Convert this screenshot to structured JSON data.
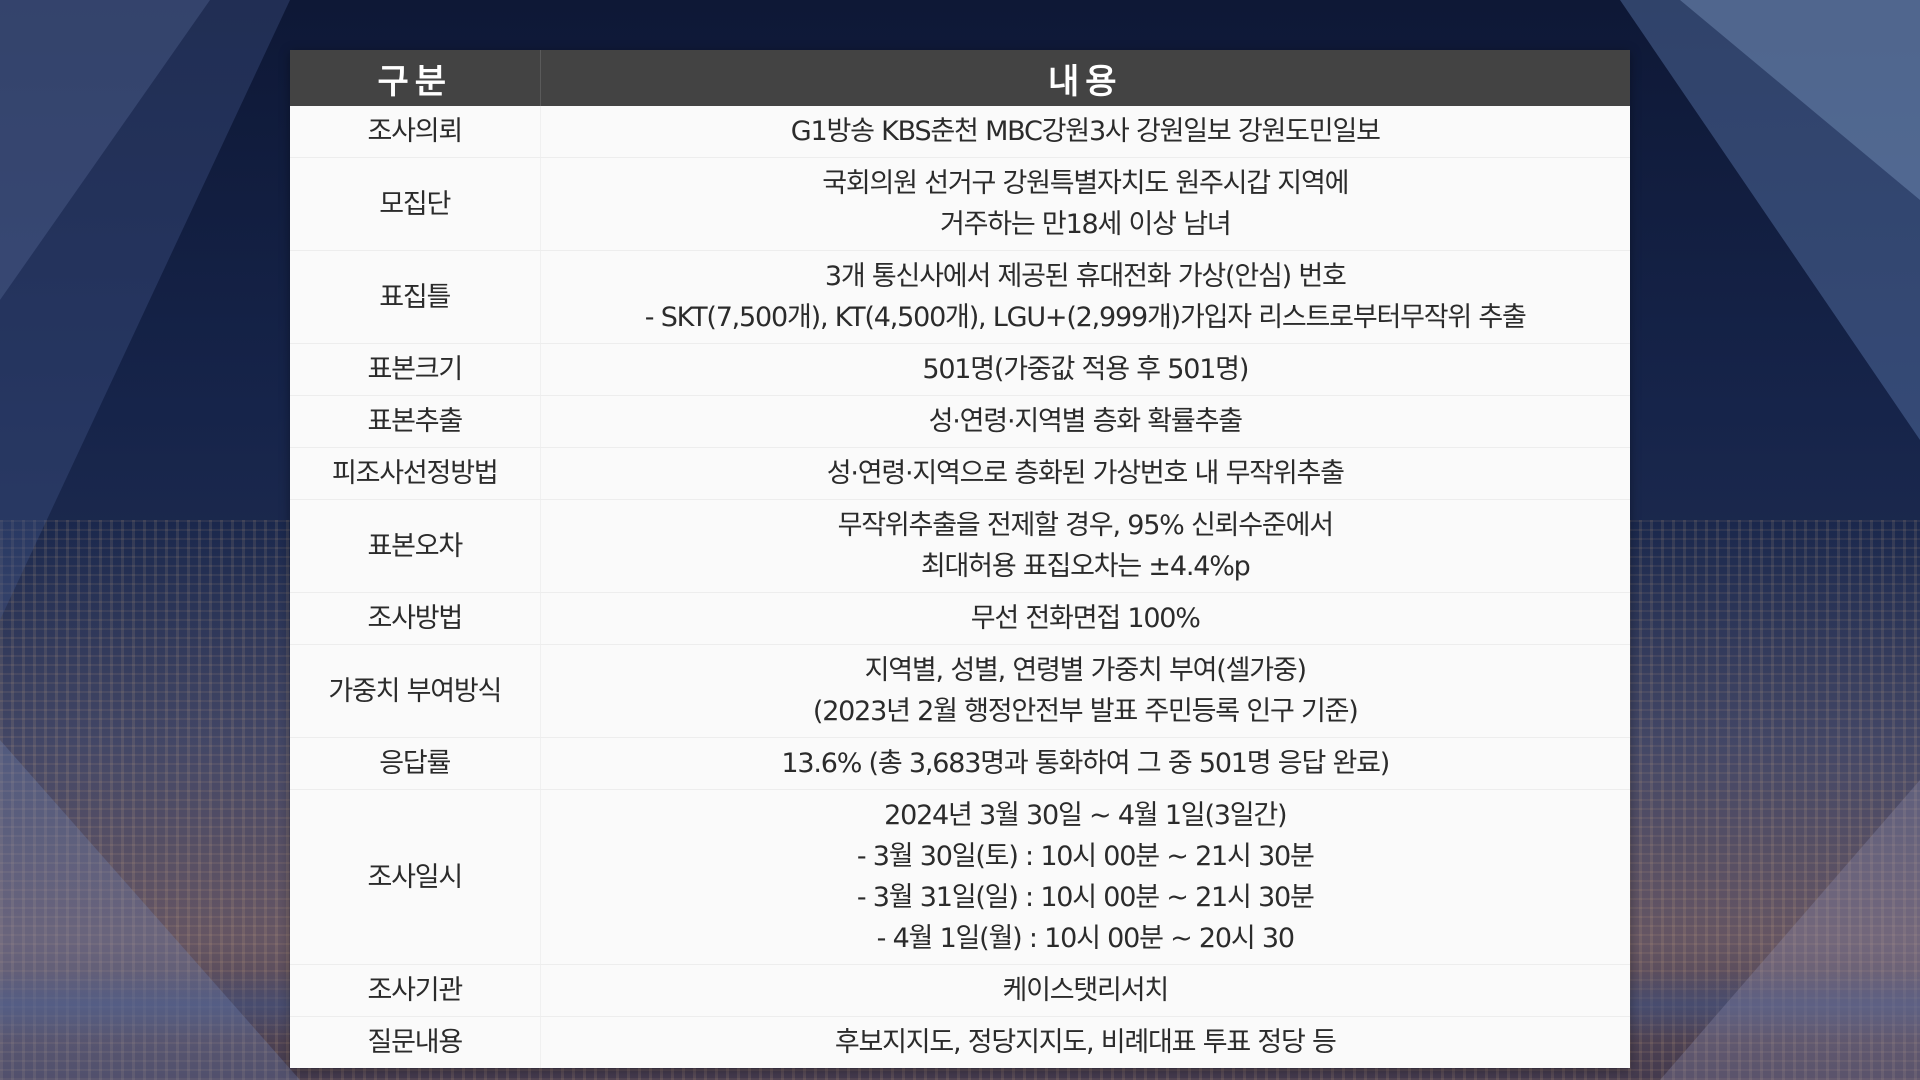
{
  "table": {
    "header": {
      "col1": "구분",
      "col2": "내용"
    },
    "rows": [
      {
        "label": "조사의뢰",
        "lines": [
          "G1방송 KBS춘천 MBC강원3사 강원일보 강원도민일보"
        ]
      },
      {
        "label": "모집단",
        "lines": [
          "국회의원 선거구 강원특별자치도 원주시갑 지역에",
          "거주하는 만18세 이상 남녀"
        ]
      },
      {
        "label": "표집틀",
        "lines": [
          "3개 통신사에서 제공된 휴대전화 가상(안심) 번호",
          "- SKT(7,500개), KT(4,500개), LGU+(2,999개)가입자 리스트로부터무작위 추출"
        ]
      },
      {
        "label": "표본크기",
        "lines": [
          "501명(가중값 적용 후 501명)"
        ]
      },
      {
        "label": "표본추출",
        "lines": [
          "성·연령·지역별 층화 확률추출"
        ]
      },
      {
        "label": "피조사선정방법",
        "lines": [
          "성·연령·지역으로 층화된 가상번호 내 무작위추출"
        ]
      },
      {
        "label": "표본오차",
        "lines": [
          "무작위추출을 전제할 경우, 95% 신뢰수준에서",
          "최대허용 표집오차는 ±4.4%p"
        ]
      },
      {
        "label": "조사방법",
        "lines": [
          "무선 전화면접 100%"
        ]
      },
      {
        "label": "가중치 부여방식",
        "lines": [
          "지역별, 성별, 연령별 가중치 부여(셀가중)",
          "(2023년 2월 행정안전부 발표 주민등록 인구 기준)"
        ]
      },
      {
        "label": "응답률",
        "lines": [
          "13.6% (총 3,683명과 통화하여 그 중 501명 응답 완료)"
        ]
      },
      {
        "label": "조사일시",
        "lines": [
          "2024년 3월 30일 ~ 4월 1일(3일간)",
          "- 3월 30일(토) : 10시 00분 ~ 21시 30분",
          "- 3월 31일(일) : 10시 00분 ~ 21시 30분",
          "- 4월 1일(월) : 10시 00분 ~ 20시 30"
        ]
      },
      {
        "label": "조사기관",
        "lines": [
          "케이스탯리서치"
        ]
      },
      {
        "label": "질문내용",
        "lines": [
          "후보지지도, 정당지지도, 비례대표 투표 정당 등"
        ]
      }
    ]
  }
}
